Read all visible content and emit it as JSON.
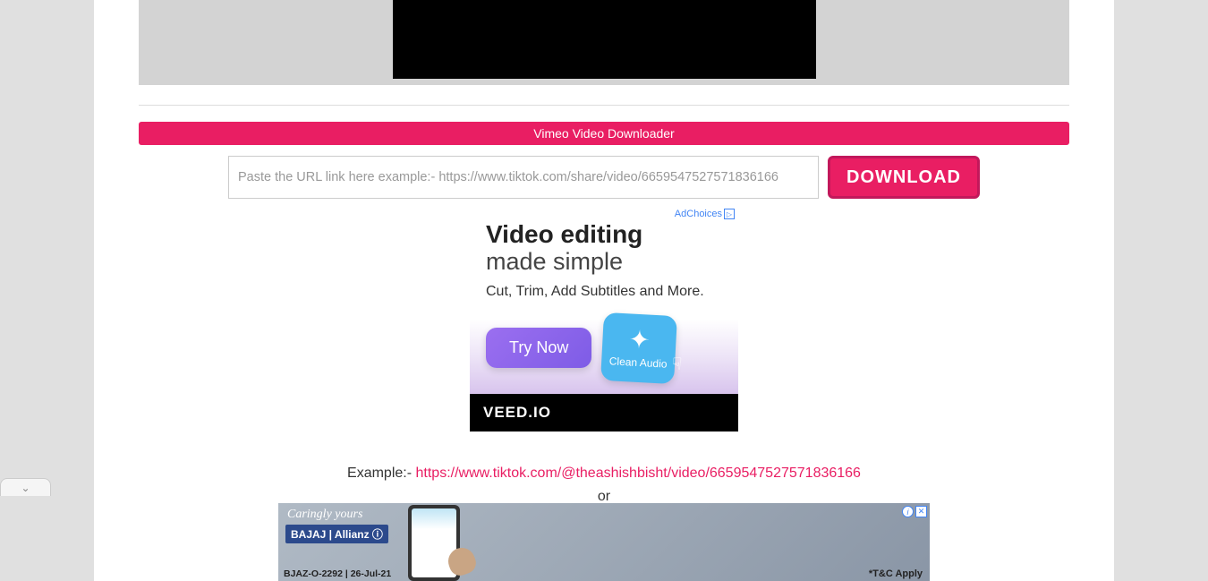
{
  "header": {
    "title": "Vimeo Video Downloader"
  },
  "form": {
    "placeholder": "Paste the URL link here example:- https://www.tiktok.com/share/video/6659547527571836166",
    "download_label": "DOWNLOAD"
  },
  "ad_main": {
    "adchoices_label": "AdChoices",
    "title": "Video editing",
    "subtitle": "made simple",
    "description": "Cut, Trim, Add Subtitles and More.",
    "try_now_label": "Try Now",
    "clean_audio_label": "Clean Audio",
    "brand": "VEED.IO"
  },
  "example": {
    "prefix": "Example:- ",
    "url": "https://www.tiktok.com/@theashishbisht/video/6659547527571836166",
    "or": "or"
  },
  "bottom_ad": {
    "caringly": "Caringly yours",
    "brand": "BAJAJ | Allianz ⓘ",
    "code": "BJAZ-O-2292 | 26-Jul-21",
    "tc": "*T&C Apply"
  }
}
